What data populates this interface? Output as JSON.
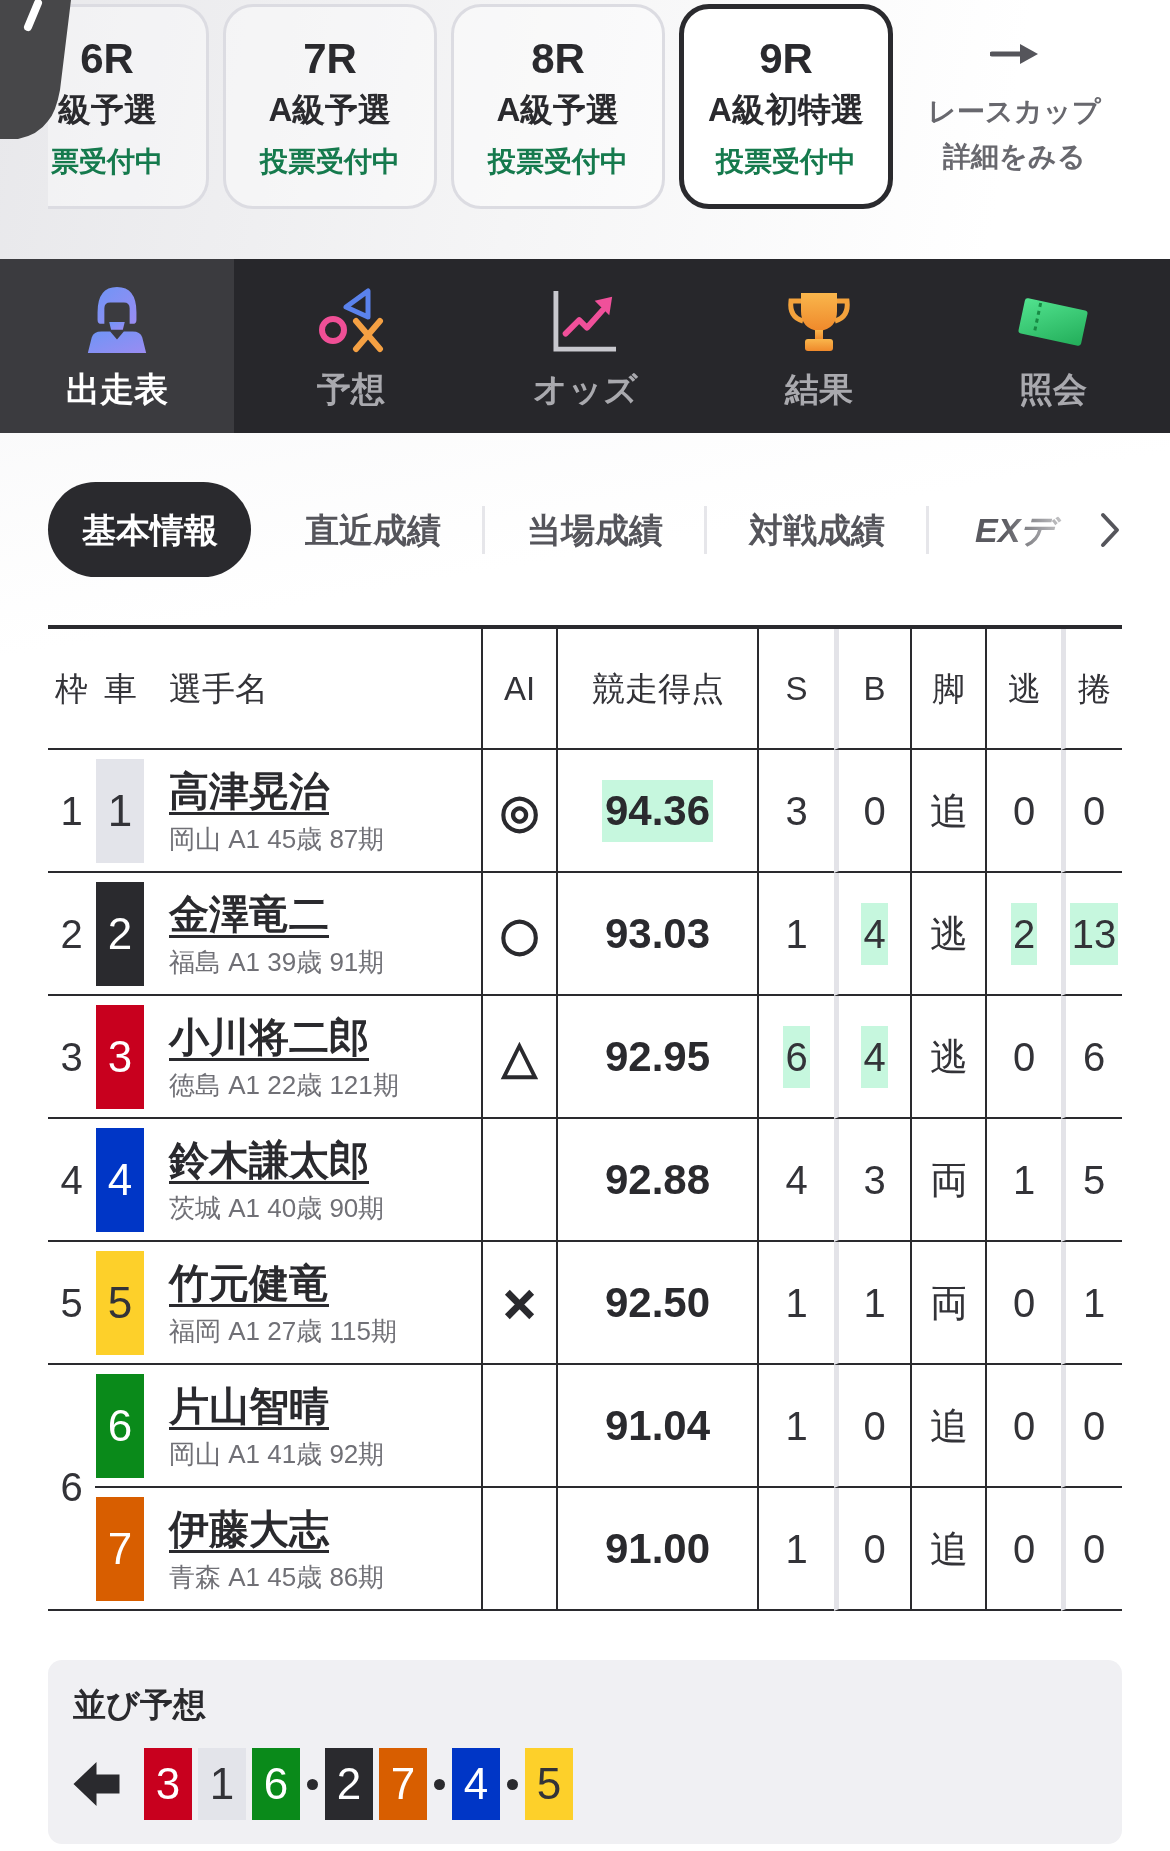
{
  "race_tabs": [
    {
      "kind": "partial",
      "race": "6R",
      "class": "級予選",
      "status": "票受付中",
      "selected": false
    },
    {
      "kind": "full",
      "race": "7R",
      "class": "A級予選",
      "status": "投票受付中",
      "selected": false
    },
    {
      "kind": "full",
      "race": "8R",
      "class": "A級予選",
      "status": "投票受付中",
      "selected": false
    },
    {
      "kind": "full",
      "race": "9R",
      "class": "A級初特選",
      "status": "投票受付中",
      "selected": true
    }
  ],
  "cup_link": {
    "lines": [
      "レースカップ",
      "詳細をみる"
    ]
  },
  "nav": [
    {
      "label": "出走表",
      "selected": true
    },
    {
      "label": "予想",
      "selected": false
    },
    {
      "label": "オッズ",
      "selected": false
    },
    {
      "label": "結果",
      "selected": false
    },
    {
      "label": "照会",
      "selected": false
    }
  ],
  "info_tabs": [
    {
      "label": "基本情報",
      "selected": true,
      "italic": false
    },
    {
      "label": "直近成績",
      "selected": false,
      "italic": false
    },
    {
      "label": "当場成績",
      "selected": false,
      "italic": false
    },
    {
      "label": "対戦成績",
      "selected": false,
      "italic": false
    },
    {
      "label": "EXデ",
      "selected": false,
      "italic": true
    }
  ],
  "table": {
    "columns": [
      "枠",
      "車",
      "選手名",
      "AI",
      "競走得点",
      "S",
      "B",
      "脚",
      "逃",
      "捲"
    ],
    "frames": [
      {
        "number": "1",
        "riders": [
          {
            "car": "1",
            "color": "#e3e4ea",
            "name": "高津晃治",
            "profile": "岡山 A1 45歳 87期",
            "ai": "◎",
            "score": {
              "value": "94.36",
              "highlighted": true
            },
            "s": {
              "value": "3",
              "highlighted": false
            },
            "b": {
              "value": "0",
              "highlighted": false
            },
            "leg": "追",
            "nige": {
              "value": "0",
              "highlighted": false
            },
            "makuri": {
              "value": "0",
              "highlighted": false
            }
          }
        ]
      },
      {
        "number": "2",
        "riders": [
          {
            "car": "2",
            "color": "#2a2a2e",
            "name": "金澤竜二",
            "profile": "福島 A1 39歳 91期",
            "ai": "○",
            "score": {
              "value": "93.03",
              "highlighted": false
            },
            "s": {
              "value": "1",
              "highlighted": false
            },
            "b": {
              "value": "4",
              "highlighted": true
            },
            "leg": "逃",
            "nige": {
              "value": "2",
              "highlighted": true
            },
            "makuri": {
              "value": "13",
              "highlighted": true
            }
          }
        ]
      },
      {
        "number": "3",
        "riders": [
          {
            "car": "3",
            "color": "#c8001e",
            "name": "小川将二郎",
            "profile": "徳島 A1 22歳 121期",
            "ai": "△",
            "score": {
              "value": "92.95",
              "highlighted": false
            },
            "s": {
              "value": "6",
              "highlighted": true
            },
            "b": {
              "value": "4",
              "highlighted": true
            },
            "leg": "逃",
            "nige": {
              "value": "0",
              "highlighted": false
            },
            "makuri": {
              "value": "6",
              "highlighted": false
            }
          }
        ]
      },
      {
        "number": "4",
        "riders": [
          {
            "car": "4",
            "color": "#0036c6",
            "name": "鈴木謙太郎",
            "profile": "茨城 A1 40歳 90期",
            "score": {
              "value": "92.88",
              "highlighted": false
            },
            "s": {
              "value": "4",
              "highlighted": false
            },
            "b": {
              "value": "3",
              "highlighted": false
            },
            "leg": "両",
            "nige": {
              "value": "1",
              "highlighted": false
            },
            "makuri": {
              "value": "5",
              "highlighted": false
            }
          }
        ]
      },
      {
        "number": "5",
        "riders": [
          {
            "car": "5",
            "color": "#fdd02a",
            "name": "竹元健竜",
            "profile": "福岡 A1 27歳 115期",
            "ai": "×",
            "score": {
              "value": "92.50",
              "highlighted": false
            },
            "s": {
              "value": "1",
              "highlighted": false
            },
            "b": {
              "value": "1",
              "highlighted": false
            },
            "leg": "両",
            "nige": {
              "value": "0",
              "highlighted": false
            },
            "makuri": {
              "value": "1",
              "highlighted": false
            }
          }
        ]
      },
      {
        "number": "6",
        "riders": [
          {
            "car": "6",
            "color": "#0a8a1a",
            "name": "片山智晴",
            "profile": "岡山 A1 41歳 92期",
            "score": {
              "value": "91.04",
              "highlighted": false
            },
            "s": {
              "value": "1",
              "highlighted": false
            },
            "b": {
              "value": "0",
              "highlighted": false
            },
            "leg": "追",
            "nige": {
              "value": "0",
              "highlighted": false
            },
            "makuri": {
              "value": "0",
              "highlighted": false
            }
          },
          {
            "car": "7",
            "color": "#d85e00",
            "name": "伊藤大志",
            "profile": "青森 A1 45歳 86期",
            "score": {
              "value": "91.00",
              "highlighted": false
            },
            "s": {
              "value": "1",
              "highlighted": false
            },
            "b": {
              "value": "0",
              "highlighted": false
            },
            "leg": "追",
            "nige": {
              "value": "0",
              "highlighted": false
            },
            "makuri": {
              "value": "0",
              "highlighted": false
            }
          }
        ]
      }
    ]
  },
  "line_prediction": {
    "title": "並び予想",
    "groups": [
      [
        {
          "car": "3",
          "color": "#c8001e"
        },
        {
          "car": "1",
          "color": "#e3e4ea"
        },
        {
          "car": "6",
          "color": "#0a8a1a"
        }
      ],
      [
        {
          "car": "2",
          "color": "#2a2a2e"
        },
        {
          "car": "7",
          "color": "#d85e00"
        }
      ],
      [
        {
          "car": "4",
          "color": "#0036c6"
        }
      ],
      [
        {
          "car": "5",
          "color": "#fdd02a"
        }
      ]
    ]
  }
}
